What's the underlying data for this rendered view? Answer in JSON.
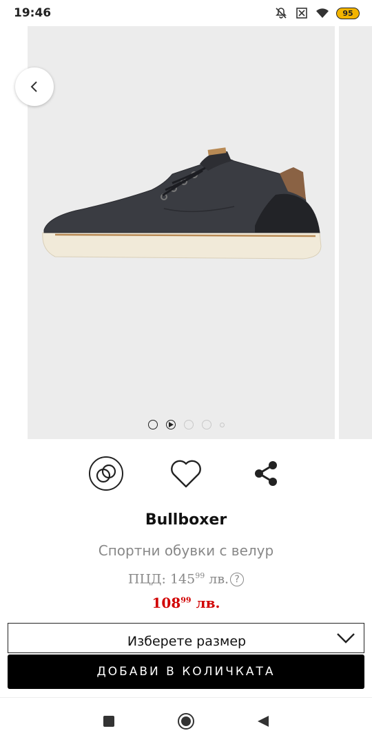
{
  "status_bar": {
    "time": "19:46",
    "battery": "95",
    "icons": [
      "mute-icon",
      "sim-off-icon",
      "wifi-icon",
      "battery-icon"
    ]
  },
  "gallery": {
    "slide_count": 5,
    "active_slide": 1,
    "icons": [
      "back-chevron-icon",
      "play-icon"
    ]
  },
  "actions": {
    "icons": [
      "compare-rings-icon",
      "heart-icon",
      "share-icon"
    ]
  },
  "product": {
    "brand": "Bullboxer",
    "name": "Спортни обувки с велур",
    "rrp_label": "ПЦД: ",
    "rrp_int": "145",
    "rrp_dec": "99",
    "rrp_currency": " лв.",
    "rrp_help": "?",
    "price_int": "108",
    "price_dec": "99",
    "price_currency": " лв."
  },
  "size_select": {
    "label": "Изберете размер"
  },
  "cart": {
    "add_label": "ДОБАВИ В КОЛИЧКАТА"
  },
  "colors": {
    "price": "#d10000",
    "button": "#000000",
    "muted_text": "#888888"
  }
}
